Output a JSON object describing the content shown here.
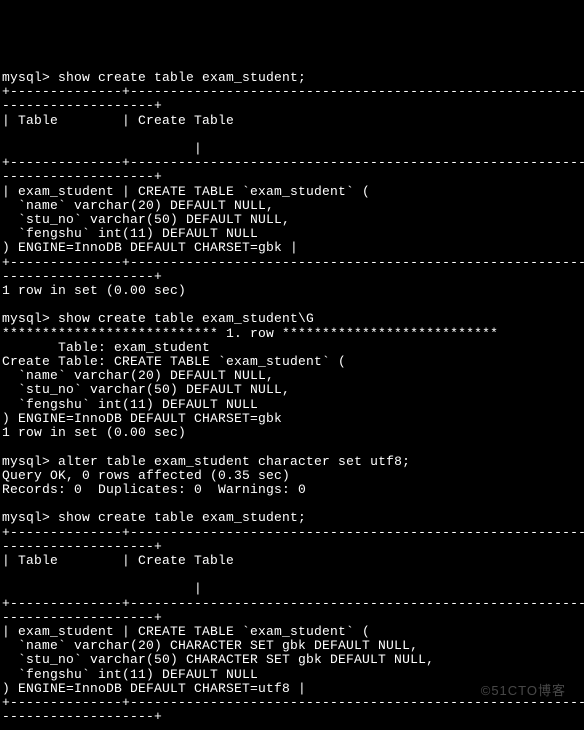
{
  "prompt": "mysql>",
  "sep_long": "+--------------+-----------------------------------------------------------------------------------------------------------------------------------------+",
  "sep_cont": "-------------------+",
  "cmd1": " show create table exam_student;",
  "header_row": "| Table        | Create Table",
  "header_pad": "                        |",
  "body1_l1": "| exam_student | CREATE TABLE `exam_student` (",
  "body1_l2": "  `name` varchar(20) DEFAULT NULL,",
  "body1_l3": "  `stu_no` varchar(50) DEFAULT NULL,",
  "body1_l4": "  `fengshu` int(11) DEFAULT NULL",
  "body1_l5": ") ENGINE=InnoDB DEFAULT CHARSET=gbk |",
  "rows_msg": "1 row in set (0.00 sec)",
  "cmd2": " show create table exam_student\\G",
  "stars_row": "*************************** 1. row ***************************",
  "g_l1": "       Table: exam_student",
  "g_l2": "Create Table: CREATE TABLE `exam_student` (",
  "g_l3": "  `name` varchar(20) DEFAULT NULL,",
  "g_l4": "  `stu_no` varchar(50) DEFAULT NULL,",
  "g_l5": "  `fengshu` int(11) DEFAULT NULL",
  "g_l6": ") ENGINE=InnoDB DEFAULT CHARSET=gbk",
  "cmd3": " alter table exam_student character set utf8;",
  "alter_l1": "Query OK, 0 rows affected (0.35 sec)",
  "alter_l2": "Records: 0  Duplicates: 0  Warnings: 0",
  "cmd4": " show create table exam_student;",
  "body2_l1": "| exam_student | CREATE TABLE `exam_student` (",
  "body2_l2": "  `name` varchar(20) CHARACTER SET gbk DEFAULT NULL,",
  "body2_l3": "  `stu_no` varchar(50) CHARACTER SET gbk DEFAULT NULL,",
  "body2_l4": "  `fengshu` int(11) DEFAULT NULL",
  "body2_l5": ") ENGINE=InnoDB DEFAULT CHARSET=utf8 |",
  "watermark": "©51CTO博客"
}
